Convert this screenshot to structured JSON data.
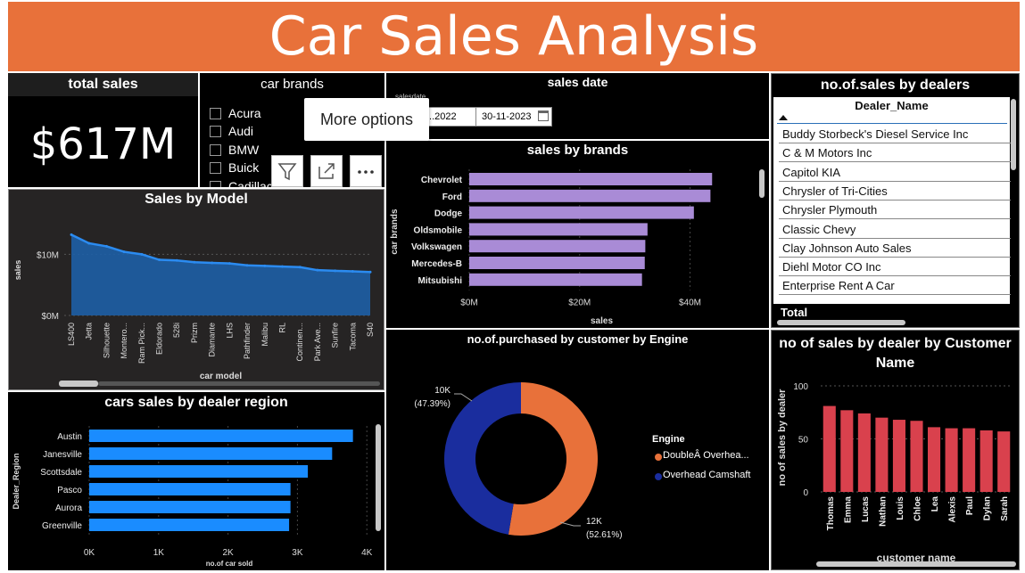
{
  "header": {
    "title": "Car Sales Analysis"
  },
  "total_sales": {
    "title": "total sales",
    "value": "$617M"
  },
  "car_brands_slicer": {
    "title": "car brands",
    "items": [
      "Acura",
      "Audi",
      "BMW",
      "Buick",
      "Cadillac"
    ]
  },
  "tooltip": {
    "label": "More options"
  },
  "sales_date": {
    "title": "sales date",
    "field_label": "salesdate",
    "start": "...2022",
    "end": "30-11-2023"
  },
  "dealers_table": {
    "title": "no.of.sales by dealers",
    "column": "Dealer_Name",
    "rows": [
      "Buddy Storbeck's Diesel Service Inc",
      "C & M Motors Inc",
      "Capitol KIA",
      "Chrysler of Tri-Cities",
      "Chrysler Plymouth",
      "Classic Chevy",
      "Clay Johnson Auto Sales",
      "Diehl Motor CO Inc",
      "Enterprise Rent A Car"
    ],
    "total_label": "Total"
  },
  "colors": {
    "header": "#e8713a",
    "brands_bar": "#a98bd6",
    "area": "#1e5fa6",
    "area_line": "#2b8bf0",
    "region_bar": "#1a8cff",
    "donut_orange": "#e8713a",
    "donut_blue": "#1a2d9e",
    "customer_bar": "#d9414d"
  },
  "chart_data": [
    {
      "id": "sales_by_model",
      "type": "area",
      "title": "Sales by Model",
      "xlabel": "car model",
      "ylabel": "sales",
      "categories": [
        "LS400",
        "Jetta",
        "Silhouette",
        "Montero...",
        "Ram Pick...",
        "Eldorado",
        "528i",
        "Prizm",
        "Diamante",
        "LHS",
        "Pathfinder",
        "Malibu",
        "RL",
        "Continen...",
        "Park Ave...",
        "Sunfire",
        "Tacoma",
        "S40"
      ],
      "values": [
        13.2,
        11.8,
        11.3,
        10.4,
        10.0,
        9.1,
        9.0,
        8.7,
        8.6,
        8.5,
        8.2,
        8.1,
        8.0,
        7.9,
        7.4,
        7.3,
        7.2,
        7.1
      ],
      "yticks": [
        "$0M",
        "$10M"
      ],
      "ylim": [
        0,
        15
      ]
    },
    {
      "id": "sales_by_brands",
      "type": "bar",
      "title": "sales by brands",
      "xlabel": "sales",
      "ylabel": "car brands",
      "categories": [
        "Chevrolet",
        "Ford",
        "Dodge",
        "Oldsmobile",
        "Volkswagen",
        "Mercedes-B",
        "Mitsubishi"
      ],
      "values": [
        44.0,
        43.7,
        40.7,
        32.3,
        31.9,
        31.8,
        31.3
      ],
      "xticks": [
        "$0M",
        "$20M",
        "$40M"
      ],
      "xlim": [
        0,
        48
      ]
    },
    {
      "id": "sales_by_region",
      "type": "bar",
      "title": "cars sales by dealer region",
      "xlabel": "no.of car sold",
      "ylabel": "Dealer_Region",
      "categories": [
        "Austin",
        "Janesville",
        "Scottsdale",
        "Pasco",
        "Aurora",
        "Greenville"
      ],
      "values": [
        3800,
        3500,
        3150,
        2900,
        2900,
        2880
      ],
      "xticks": [
        "0K",
        "1K",
        "2K",
        "3K",
        "4K"
      ],
      "xlim": [
        0,
        4100
      ]
    },
    {
      "id": "engine_donut",
      "type": "pie",
      "title": "no.of.purchased by customer by Engine",
      "legend_title": "Engine",
      "series": [
        {
          "name": "DoubleÂ Overhea...",
          "value": 12,
          "label": "12K",
          "pct": "(52.61%)"
        },
        {
          "name": "Overhead Camshaft",
          "value": 10,
          "label": "10K",
          "pct": "(47.39%)"
        }
      ],
      "percentages": [
        52.61,
        47.39
      ]
    },
    {
      "id": "sales_by_customer",
      "type": "bar",
      "title": "no of sales by dealer by Customer Name",
      "xlabel": "customer name",
      "ylabel": "no of sales by dealer",
      "categories": [
        "Thomas",
        "Emma",
        "Lucas",
        "Nathan",
        "Louis",
        "Chloe",
        "Lea",
        "Alexis",
        "Paul",
        "Dylan",
        "Sarah"
      ],
      "values": [
        81,
        77,
        74,
        70,
        68,
        67,
        61,
        60,
        60,
        58,
        57
      ],
      "yticks": [
        "0",
        "50",
        "100"
      ],
      "ylim": [
        0,
        105
      ]
    }
  ]
}
